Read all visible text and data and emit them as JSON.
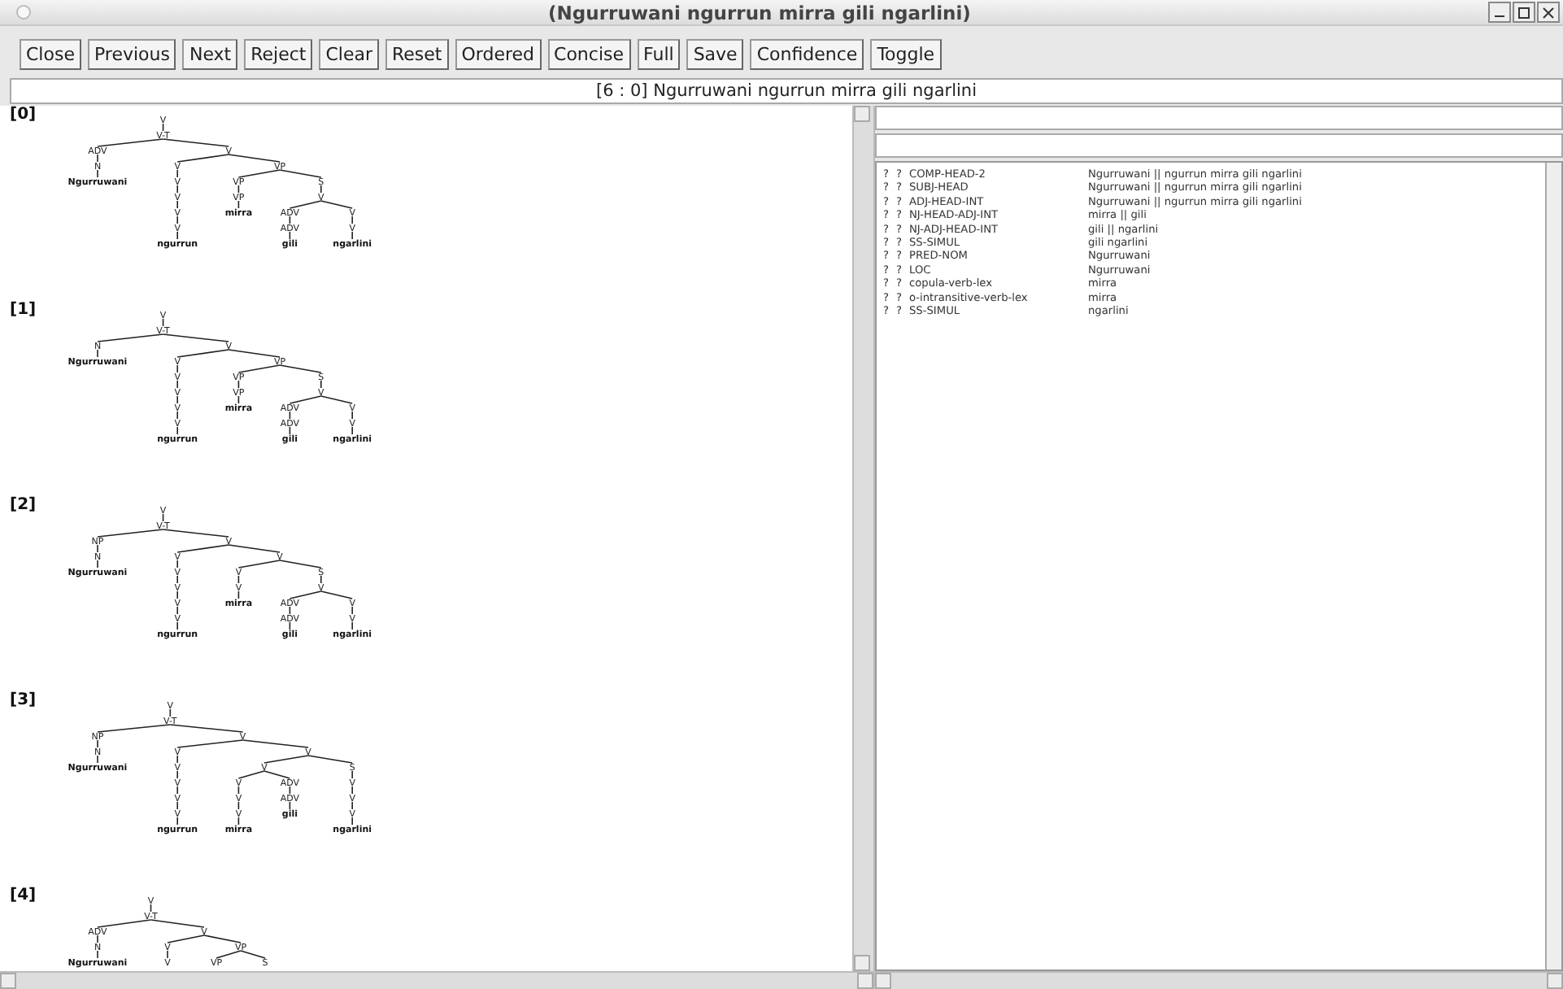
{
  "window": {
    "title": "(Ngurruwani ngurrun mirra gili ngarlini)"
  },
  "toolbar": [
    "Close",
    "Previous",
    "Next",
    "Reject",
    "Clear",
    "Reset",
    "Ordered",
    "Concise",
    "Full",
    "Save",
    "Confidence",
    "Toggle"
  ],
  "status": "[6 : 0]  Ngurruwani ngurrun mirra gili ngarlini",
  "trees": [
    {
      "index": "[0]",
      "root": {
        "label": "V",
        "children": [
          {
            "label": "V-T",
            "children": [
              {
                "label": "ADV",
                "children": [
                  {
                    "label": "N",
                    "children": [
                      {
                        "label": "Ngurruwani"
                      }
                    ]
                  }
                ]
              },
              {
                "label": "V",
                "children": [
                  {
                    "label": "V",
                    "children": [
                      {
                        "label": "V",
                        "children": [
                          {
                            "label": "V",
                            "children": [
                              {
                                "label": "V",
                                "children": [
                                  {
                                    "label": "V",
                                    "children": [
                                      {
                                        "label": "ngurrun"
                                      }
                                    ]
                                  }
                                ]
                              }
                            ]
                          }
                        ]
                      }
                    ]
                  },
                  {
                    "label": "VP",
                    "children": [
                      {
                        "label": "VP",
                        "children": [
                          {
                            "label": "VP",
                            "children": [
                              {
                                "label": "mirra"
                              }
                            ]
                          }
                        ]
                      },
                      {
                        "label": "S",
                        "children": [
                          {
                            "label": "V",
                            "children": [
                              {
                                "label": "ADV",
                                "children": [
                                  {
                                    "label": "ADV",
                                    "children": [
                                      {
                                        "label": "gili"
                                      }
                                    ]
                                  }
                                ]
                              },
                              {
                                "label": "V",
                                "children": [
                                  {
                                    "label": "V",
                                    "children": [
                                      {
                                        "label": "ngarlini"
                                      }
                                    ]
                                  }
                                ]
                              }
                            ]
                          }
                        ]
                      }
                    ]
                  }
                ]
              }
            ]
          }
        ]
      }
    },
    {
      "index": "[1]",
      "root": {
        "label": "V",
        "children": [
          {
            "label": "V-T",
            "children": [
              {
                "label": "N",
                "children": [
                  {
                    "label": "Ngurruwani"
                  }
                ]
              },
              {
                "label": "V",
                "children": [
                  {
                    "label": "V",
                    "children": [
                      {
                        "label": "V",
                        "children": [
                          {
                            "label": "V",
                            "children": [
                              {
                                "label": "V",
                                "children": [
                                  {
                                    "label": "V",
                                    "children": [
                                      {
                                        "label": "ngurrun"
                                      }
                                    ]
                                  }
                                ]
                              }
                            ]
                          }
                        ]
                      }
                    ]
                  },
                  {
                    "label": "VP",
                    "children": [
                      {
                        "label": "VP",
                        "children": [
                          {
                            "label": "VP",
                            "children": [
                              {
                                "label": "mirra"
                              }
                            ]
                          }
                        ]
                      },
                      {
                        "label": "S",
                        "children": [
                          {
                            "label": "V",
                            "children": [
                              {
                                "label": "ADV",
                                "children": [
                                  {
                                    "label": "ADV",
                                    "children": [
                                      {
                                        "label": "gili"
                                      }
                                    ]
                                  }
                                ]
                              },
                              {
                                "label": "V",
                                "children": [
                                  {
                                    "label": "V",
                                    "children": [
                                      {
                                        "label": "ngarlini"
                                      }
                                    ]
                                  }
                                ]
                              }
                            ]
                          }
                        ]
                      }
                    ]
                  }
                ]
              }
            ]
          }
        ]
      }
    },
    {
      "index": "[2]",
      "root": {
        "label": "V",
        "children": [
          {
            "label": "V-T",
            "children": [
              {
                "label": "NP",
                "children": [
                  {
                    "label": "N",
                    "children": [
                      {
                        "label": "Ngurruwani"
                      }
                    ]
                  }
                ]
              },
              {
                "label": "V",
                "children": [
                  {
                    "label": "V",
                    "children": [
                      {
                        "label": "V",
                        "children": [
                          {
                            "label": "V",
                            "children": [
                              {
                                "label": "V",
                                "children": [
                                  {
                                    "label": "V",
                                    "children": [
                                      {
                                        "label": "ngurrun"
                                      }
                                    ]
                                  }
                                ]
                              }
                            ]
                          }
                        ]
                      }
                    ]
                  },
                  {
                    "label": "V",
                    "children": [
                      {
                        "label": "V",
                        "children": [
                          {
                            "label": "V",
                            "children": [
                              {
                                "label": "mirra"
                              }
                            ]
                          }
                        ]
                      },
                      {
                        "label": "S",
                        "children": [
                          {
                            "label": "V",
                            "children": [
                              {
                                "label": "ADV",
                                "children": [
                                  {
                                    "label": "ADV",
                                    "children": [
                                      {
                                        "label": "gili"
                                      }
                                    ]
                                  }
                                ]
                              },
                              {
                                "label": "V",
                                "children": [
                                  {
                                    "label": "V",
                                    "children": [
                                      {
                                        "label": "ngarlini"
                                      }
                                    ]
                                  }
                                ]
                              }
                            ]
                          }
                        ]
                      }
                    ]
                  }
                ]
              }
            ]
          }
        ]
      }
    },
    {
      "index": "[3]",
      "root": {
        "label": "V",
        "children": [
          {
            "label": "V-T",
            "children": [
              {
                "label": "NP",
                "children": [
                  {
                    "label": "N",
                    "children": [
                      {
                        "label": "Ngurruwani"
                      }
                    ]
                  }
                ]
              },
              {
                "label": "V",
                "children": [
                  {
                    "label": "V",
                    "children": [
                      {
                        "label": "V",
                        "children": [
                          {
                            "label": "V",
                            "children": [
                              {
                                "label": "V",
                                "children": [
                                  {
                                    "label": "V",
                                    "children": [
                                      {
                                        "label": "ngurrun"
                                      }
                                    ]
                                  }
                                ]
                              }
                            ]
                          }
                        ]
                      }
                    ]
                  },
                  {
                    "label": "V",
                    "children": [
                      {
                        "label": "V",
                        "children": [
                          {
                            "label": "V",
                            "children": [
                              {
                                "label": "V",
                                "children": [
                                  {
                                    "label": "V",
                                    "children": [
                                      {
                                        "label": "mirra"
                                      }
                                    ]
                                  }
                                ]
                              }
                            ]
                          },
                          {
                            "label": "ADV",
                            "children": [
                              {
                                "label": "ADV",
                                "children": [
                                  {
                                    "label": "gili"
                                  }
                                ]
                              }
                            ]
                          }
                        ]
                      },
                      {
                        "label": "S",
                        "children": [
                          {
                            "label": "V",
                            "children": [
                              {
                                "label": "V",
                                "children": [
                                  {
                                    "label": "V",
                                    "children": [
                                      {
                                        "label": "ngarlini"
                                      }
                                    ]
                                  }
                                ]
                              }
                            ]
                          }
                        ]
                      }
                    ]
                  }
                ]
              }
            ]
          }
        ]
      }
    },
    {
      "index": "[4]",
      "root": {
        "label": "V",
        "children": [
          {
            "label": "V-T",
            "children": [
              {
                "label": "ADV",
                "children": [
                  {
                    "label": "N",
                    "children": [
                      {
                        "label": "Ngurruwani"
                      }
                    ]
                  }
                ]
              },
              {
                "label": "V",
                "children": [
                  {
                    "label": "V",
                    "children": [
                      {
                        "label": "V"
                      }
                    ]
                  },
                  {
                    "label": "VP",
                    "children": [
                      {
                        "label": "VP"
                      },
                      {
                        "label": "S"
                      }
                    ]
                  }
                ]
              }
            ]
          }
        ]
      }
    }
  ],
  "rules": [
    {
      "col1": "?",
      "col2": "?",
      "rule": "COMP-HEAD-2",
      "span": "Ngurruwani || ngurrun mirra gili ngarlini"
    },
    {
      "col1": "?",
      "col2": "?",
      "rule": "SUBJ-HEAD",
      "span": "Ngurruwani || ngurrun mirra gili ngarlini"
    },
    {
      "col1": "?",
      "col2": "?",
      "rule": "ADJ-HEAD-INT",
      "span": "Ngurruwani || ngurrun mirra gili ngarlini"
    },
    {
      "col1": "?",
      "col2": "?",
      "rule": "NJ-HEAD-ADJ-INT",
      "span": "mirra || gili"
    },
    {
      "col1": "?",
      "col2": "?",
      "rule": "NJ-ADJ-HEAD-INT",
      "span": "gili || ngarlini"
    },
    {
      "col1": "?",
      "col2": "?",
      "rule": "SS-SIMUL",
      "span": "gili ngarlini"
    },
    {
      "col1": "?",
      "col2": "?",
      "rule": "PRED-NOM",
      "span": "Ngurruwani"
    },
    {
      "col1": "?",
      "col2": "?",
      "rule": "LOC",
      "span": "Ngurruwani"
    },
    {
      "col1": "?",
      "col2": "?",
      "rule": "copula-verb-lex",
      "span": "mirra"
    },
    {
      "col1": "?",
      "col2": "?",
      "rule": "o-intransitive-verb-lex",
      "span": "mirra"
    },
    {
      "col1": "?",
      "col2": "?",
      "rule": "SS-SIMUL",
      "span": "ngarlini"
    }
  ]
}
